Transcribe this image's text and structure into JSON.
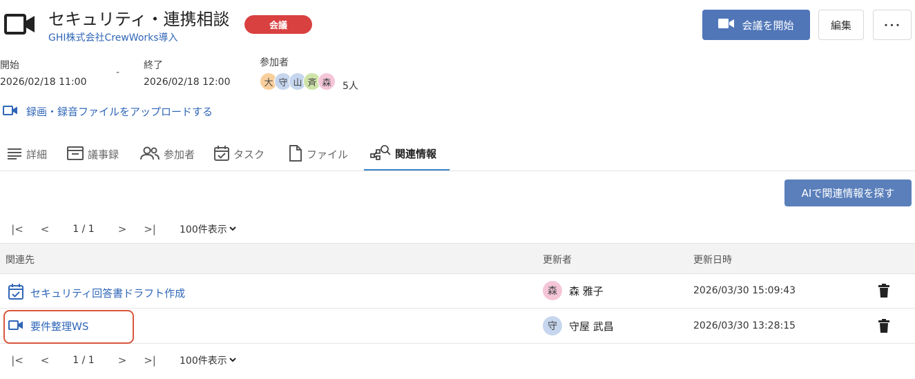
{
  "header": {
    "title": "セキュリティ・連携相談",
    "badge": "会議",
    "subtitle": "GHI株式会社CrewWorks導入",
    "start_meeting_label": "会議を開始",
    "edit_label": "編集",
    "more_label": "･･･"
  },
  "meta": {
    "start_label": "開始",
    "start_value": "2026/02/18 11:00",
    "separator": "-",
    "end_label": "終了",
    "end_value": "2026/02/18 12:00",
    "participants_label": "参加者",
    "participants": [
      {
        "initial": "大",
        "color": "#f8cf9c"
      },
      {
        "initial": "守",
        "color": "#c6d6ee"
      },
      {
        "initial": "山",
        "color": "#c6d6ee"
      },
      {
        "initial": "斉",
        "color": "#cfe3a8"
      },
      {
        "initial": "森",
        "color": "#f5c6d8"
      }
    ],
    "participants_count": "5人"
  },
  "upload_label": "録画・録音ファイルをアップロードする",
  "tabs": [
    {
      "label": "詳細",
      "icon": "list-icon"
    },
    {
      "label": "議事録",
      "icon": "minutes-icon"
    },
    {
      "label": "参加者",
      "icon": "people-icon"
    },
    {
      "label": "タスク",
      "icon": "calendar-check-icon"
    },
    {
      "label": "ファイル",
      "icon": "file-icon"
    },
    {
      "label": "関連情報",
      "icon": "related-search-icon",
      "active": true
    }
  ],
  "ai_button_label": "AIで関連情報を探す",
  "pager": {
    "first": "|<",
    "prev": "<",
    "info": "1 / 1",
    "next": ">",
    "last": ">|",
    "page_size": "100件表示"
  },
  "table": {
    "columns": [
      "関連先",
      "更新者",
      "更新日時"
    ],
    "rows": [
      {
        "icon": "task-calendar-icon",
        "title": "セキュリティ回答書ドラフト作成",
        "user_initial": "森",
        "user_name": "森 雅子",
        "user_color": "#f5c6d8",
        "updated": "2026/03/30 15:09:43"
      },
      {
        "icon": "video-camera-icon",
        "title": "要件整理WS",
        "user_initial": "守",
        "user_name": "守屋 武昌",
        "user_color": "#c6d6ee",
        "updated": "2026/03/30 13:28:15"
      }
    ]
  },
  "colors": {
    "accent": "#5076b8",
    "link": "#2f66b8",
    "badge": "#d94040",
    "highlight": "#d9553c",
    "tab_underline": "#3b82c8"
  }
}
